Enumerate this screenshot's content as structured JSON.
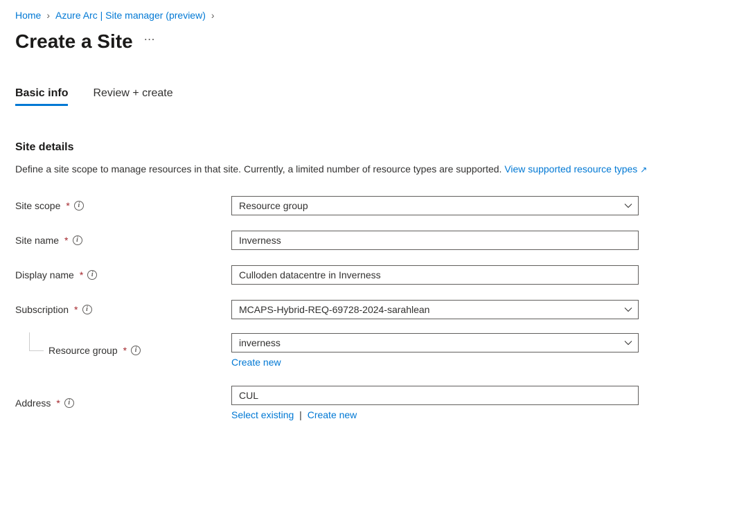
{
  "breadcrumb": {
    "home": "Home",
    "parent": "Azure Arc | Site manager (preview)"
  },
  "page": {
    "title": "Create a Site"
  },
  "tabs": {
    "basic": "Basic info",
    "review": "Review + create"
  },
  "section": {
    "heading": "Site details",
    "description_prefix": "Define a site scope to manage resources in that site. Currently, a limited number of resource types are supported. ",
    "supported_link": "View supported resource types"
  },
  "form": {
    "site_scope": {
      "label": "Site scope",
      "value": "Resource group"
    },
    "site_name": {
      "label": "Site name",
      "value": "Inverness"
    },
    "display_name": {
      "label": "Display name",
      "value": "Culloden datacentre in Inverness"
    },
    "subscription": {
      "label": "Subscription",
      "value": "MCAPS-Hybrid-REQ-69728-2024-sarahlean"
    },
    "resource_group": {
      "label": "Resource group",
      "value": "inverness",
      "create_new": "Create new"
    },
    "address": {
      "label": "Address",
      "value": "CUL",
      "select_existing": "Select existing",
      "create_new": "Create new"
    }
  }
}
